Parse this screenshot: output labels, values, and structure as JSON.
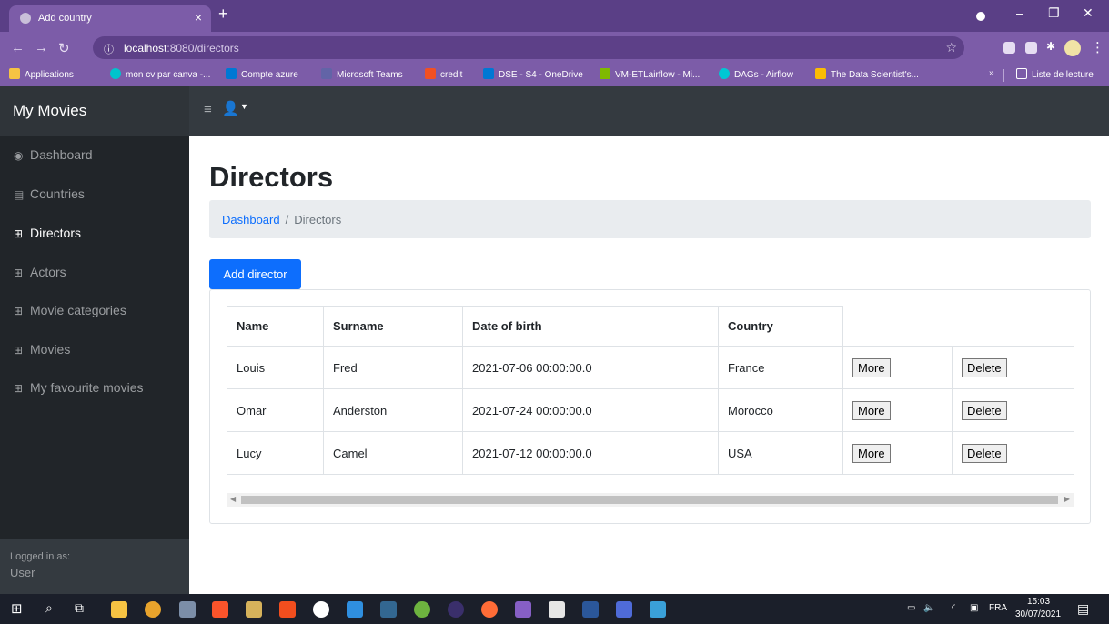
{
  "browser": {
    "tab_title": "Add country",
    "tab_close": "×",
    "new_tab": "+",
    "url_host": "localhost",
    "url_path": ":8080/directors",
    "window_controls": [
      "–",
      "❐",
      "✕"
    ],
    "bookmarks": [
      {
        "label": "Applications",
        "color": "#f6c343"
      },
      {
        "label": "mon cv par canva -...",
        "color": "#00c4cc"
      },
      {
        "label": "Compte azure",
        "color": "#0078d4"
      },
      {
        "label": "Microsoft Teams",
        "color": "#6264a7"
      },
      {
        "label": "credit",
        "color": "#f25022"
      },
      {
        "label": "DSE - S4 - OneDrive",
        "color": "#0078d4"
      },
      {
        "label": "VM-ETLairflow - Mi...",
        "color": "#7fba00"
      },
      {
        "label": "DAGs - Airflow",
        "color": "#00c7d4"
      },
      {
        "label": "The Data Scientist's...",
        "color": "#fbbc04"
      }
    ],
    "more_bookmarks": "»",
    "reading_list": "Liste de lecture"
  },
  "app": {
    "brand": "My Movies",
    "sidebar": {
      "items": [
        {
          "label": "Dashboard",
          "icon": "dashboard-icon",
          "glyph": "◉",
          "active": false
        },
        {
          "label": "Countries",
          "icon": "chart-icon",
          "glyph": "▤",
          "active": false
        },
        {
          "label": "Directors",
          "icon": "table-icon",
          "glyph": "⊞",
          "active": true
        },
        {
          "label": "Actors",
          "icon": "table-icon",
          "glyph": "⊞",
          "active": false
        },
        {
          "label": "Movie categories",
          "icon": "table-icon",
          "glyph": "⊞",
          "active": false
        },
        {
          "label": "Movies",
          "icon": "table-icon",
          "glyph": "⊞",
          "active": false
        },
        {
          "label": "My favourite movies",
          "icon": "table-icon",
          "glyph": "⊞",
          "active": false
        }
      ],
      "footer_label": "Logged in as:",
      "footer_user": "User"
    },
    "page_title": "Directors",
    "breadcrumb": {
      "home": "Dashboard",
      "separator": "/",
      "current": "Directors"
    },
    "add_button": "Add director",
    "table": {
      "headers": [
        "Name",
        "Surname",
        "Date of birth",
        "Country"
      ],
      "rows": [
        {
          "name": "Louis",
          "surname": "Fred",
          "dob": "2021-07-06 00:00:00.0",
          "country": "France"
        },
        {
          "name": "Omar",
          "surname": "Anderston",
          "dob": "2021-07-24 00:00:00.0",
          "country": "Morocco"
        },
        {
          "name": "Lucy",
          "surname": "Camel",
          "dob": "2021-07-12 00:00:00.0",
          "country": "USA"
        }
      ],
      "more_label": "More",
      "delete_label": "Delete"
    }
  },
  "taskbar": {
    "language": "FRA",
    "time": "15:03",
    "date": "30/07/2021"
  },
  "colors": {
    "accent": "#0d6efd",
    "sidebar_bg": "#212529",
    "topnav_bg": "#343a40",
    "browser_purple": "#7c5ca8"
  }
}
